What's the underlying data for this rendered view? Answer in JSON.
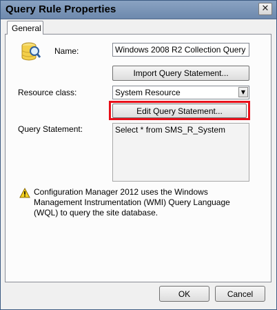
{
  "window": {
    "title": "Query Rule Properties",
    "close_glyph": "✕"
  },
  "tabs": [
    {
      "label": "General"
    }
  ],
  "form": {
    "name_label": "Name:",
    "name_value": "Windows 2008 R2 Collection Query",
    "import_button": "Import Query Statement...",
    "resource_class_label": "Resource class:",
    "resource_class_value": "System Resource",
    "edit_button": "Edit Query Statement...",
    "query_statement_label": "Query Statement:",
    "query_statement_value": "Select * from SMS_R_System"
  },
  "note": {
    "text": "Configuration Manager 2012 uses the Windows Management Instrumentation (WMI) Query Language (WQL) to query the site database."
  },
  "footer": {
    "ok_label": "OK",
    "cancel_label": "Cancel"
  },
  "icons": {
    "header": "database-query-icon",
    "note": "warning-icon"
  },
  "colors": {
    "highlight": "#e8101a",
    "titlebar": "#7a94b6"
  }
}
